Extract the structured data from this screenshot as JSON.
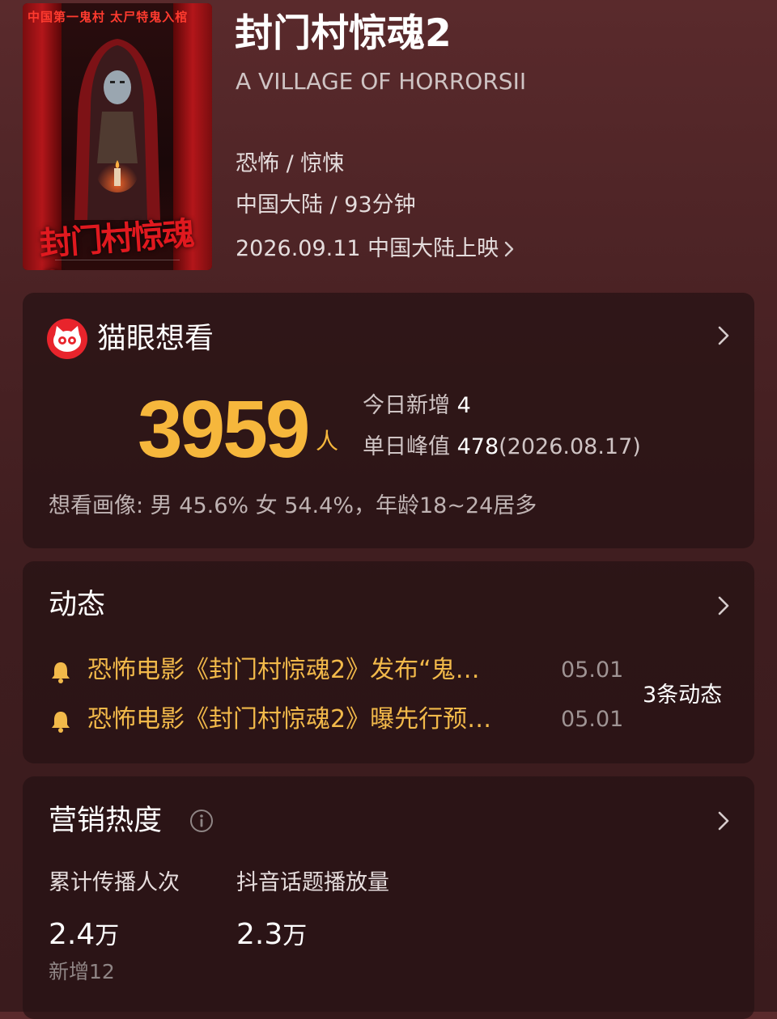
{
  "movie": {
    "title": "封门村惊魂2",
    "english_title": "A VILLAGE OF HORRORSII",
    "genre": "恐怖 / 惊悚",
    "region_runtime": "中国大陆 / 93分钟",
    "release": "2026.09.11 中国大陆上映",
    "poster": {
      "tagline": "中国第一鬼村  太尸特鬼入棺",
      "title_art": "封门村惊魂2"
    }
  },
  "want_to_see": {
    "title": "猫眼想看",
    "count": "3959",
    "unit": "人",
    "today_label": "今日新增",
    "today_value": "4",
    "peak_label": "单日峰值",
    "peak_value": "478",
    "peak_date": "(2026.08.17)",
    "portrait": "想看画像:  男 45.6%  女 54.4%，年龄18~24居多"
  },
  "news": {
    "title": "动态",
    "items": [
      {
        "text": "恐怖电影《封门村惊魂2》发布“鬼…",
        "date": "05.01"
      },
      {
        "text": "恐怖电影《封门村惊魂2》曝先行预…",
        "date": "05.01"
      }
    ],
    "count_label": "3条动态"
  },
  "marketing": {
    "title": "营销热度",
    "metrics": [
      {
        "label": "累计传播人次",
        "value": "2.4",
        "unit": "万",
        "sub": "新增12"
      },
      {
        "label": "抖音话题播放量",
        "value": "2.3",
        "unit": "万"
      }
    ]
  },
  "colors": {
    "accent_gold": "#f6b73c",
    "news_text": "#f2b94a",
    "maoyan_red": "#e8242c",
    "background": "#4a2224"
  },
  "icons": [
    "chevron-right-icon",
    "maoyan-cat-icon",
    "bell-icon",
    "info-icon"
  ]
}
